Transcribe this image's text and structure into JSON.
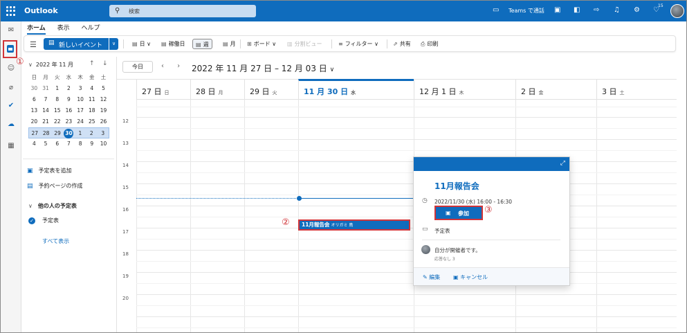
{
  "app": {
    "title": "Outlook"
  },
  "search": {
    "placeholder": "検索"
  },
  "topbar": {
    "teams_call": "Teams で通話",
    "notification_count": "15"
  },
  "ribbon": {
    "tabs": [
      "ホーム",
      "表示",
      "ヘルプ"
    ],
    "new_event": "新しいイベント",
    "view_day": "日",
    "view_workweek": "稼働日",
    "view_week": "週",
    "view_month": "月",
    "view_board": "ボード",
    "split_view": "分割ビュー",
    "filter": "フィルター",
    "share": "共有",
    "print": "印刷"
  },
  "minical": {
    "title": "2022 年 11 月",
    "dow": [
      "日",
      "月",
      "火",
      "水",
      "木",
      "金",
      "土"
    ],
    "weeks": [
      [
        "30",
        "31",
        "1",
        "2",
        "3",
        "4",
        "5"
      ],
      [
        "6",
        "7",
        "8",
        "9",
        "10",
        "11",
        "12"
      ],
      [
        "13",
        "14",
        "15",
        "16",
        "17",
        "18",
        "19"
      ],
      [
        "20",
        "21",
        "22",
        "23",
        "24",
        "25",
        "26"
      ],
      [
        "27",
        "28",
        "29",
        "30",
        "1",
        "2",
        "3"
      ],
      [
        "4",
        "5",
        "6",
        "7",
        "8",
        "9",
        "10"
      ]
    ]
  },
  "left": {
    "add_calendar": "予定表を追加",
    "create_booking": "予約ページの作成",
    "others_header": "他の人の予定表",
    "my_calendar": "予定表",
    "show_all": "すべて表示"
  },
  "calendar": {
    "today_btn": "今日",
    "range": "2022 年 11 月 27 日 – 12 月 03 日",
    "days": [
      {
        "date": "27 日",
        "dow": "日"
      },
      {
        "date": "28 日",
        "dow": "月"
      },
      {
        "date": "29 日",
        "dow": "火"
      },
      {
        "date": "11 月 30 日",
        "dow": "水"
      },
      {
        "date": "12 月 1 日",
        "dow": "木"
      },
      {
        "date": "2 日",
        "dow": "金"
      },
      {
        "date": "3 日",
        "dow": "土"
      }
    ],
    "hours": [
      "12",
      "13",
      "14",
      "15",
      "16",
      "17",
      "18",
      "19",
      "20"
    ]
  },
  "event": {
    "title": "11月報告会",
    "organizer": "オリガミ 鳥"
  },
  "popup": {
    "title": "11月報告会",
    "time": "2022/11/30 (水) 16:00 - 16:30",
    "join": "参加",
    "calendar": "予定表",
    "organizer_note": "自分が開催者です。",
    "responses": "応答なし 3",
    "edit": "編集",
    "cancel": "キャンセル"
  },
  "annotations": {
    "one": "①",
    "two": "②",
    "three": "③"
  },
  "colors": {
    "brand": "#0f6cbd",
    "highlight": "#d13438"
  }
}
